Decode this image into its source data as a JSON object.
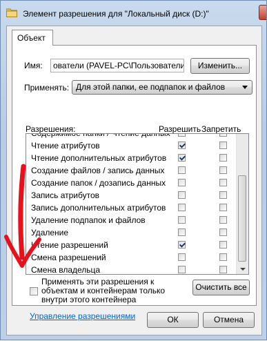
{
  "window": {
    "title": "Элемент разрешения для \"Локальный диск (D:)\""
  },
  "tabs": [
    {
      "label": "Объект"
    }
  ],
  "object_tab": {
    "name_label": "Имя:",
    "name_value": "ователи (PAVEL-PC\\Пользователи)",
    "change_button": "Изменить...",
    "apply_to_label": "Применять:",
    "apply_to_value": "Для этой папки, ее подпапок и файлов",
    "permissions_header": "Разрешения:",
    "allow_header": "Разрешить",
    "deny_header": "Запретить",
    "permissions": [
      {
        "name": "Содержимое папки / Чтение данных",
        "allow": false,
        "deny": false
      },
      {
        "name": "Чтение атрибутов",
        "allow": true,
        "deny": false
      },
      {
        "name": "Чтение дополнительных атрибутов",
        "allow": true,
        "deny": false
      },
      {
        "name": "Создание файлов / запись данных",
        "allow": false,
        "deny": false
      },
      {
        "name": "Создание папок / дозапись данных",
        "allow": false,
        "deny": false
      },
      {
        "name": "Запись атрибутов",
        "allow": false,
        "deny": false
      },
      {
        "name": "Запись дополнительных атрибутов",
        "allow": false,
        "deny": false
      },
      {
        "name": "Удаление подпапок и файлов",
        "allow": false,
        "deny": false
      },
      {
        "name": "Удаление",
        "allow": false,
        "deny": false
      },
      {
        "name": "Чтение разрешений",
        "allow": true,
        "deny": false
      },
      {
        "name": "Смена разрешений",
        "allow": false,
        "deny": false
      },
      {
        "name": "Смена владельца",
        "allow": false,
        "deny": false
      }
    ],
    "apply_inside_text": "Применять эти разрешения к объектам и контейнерам только внутри этого контейнера",
    "apply_inside_checked": false,
    "clear_all_button": "Очистить все",
    "manage_link": "Управление разрешениями"
  },
  "footer": {
    "ok_button": "ОК",
    "cancel_button": "Отмена"
  },
  "colors": {
    "annotation_arrow": "#e8101a",
    "link": "#0066cc",
    "window_frame": "#bdd0e8"
  },
  "icons": {
    "title_icon": "folder-icon"
  }
}
